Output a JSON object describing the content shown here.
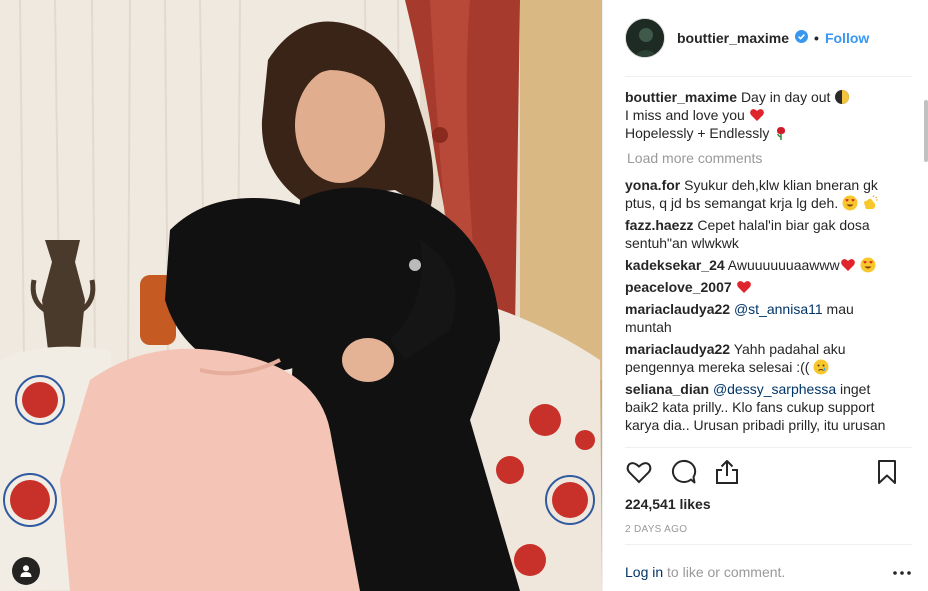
{
  "header": {
    "username": "bouttier_maxime",
    "separator": "•",
    "follow_label": "Follow"
  },
  "caption": {
    "username": "bouttier_maxime",
    "line1": "Day in day out",
    "line1_emoji": "moon-icon",
    "line2": "I miss and love you",
    "line2_emoji": "red-heart-icon",
    "line3": "Hopelessly + Endlessly",
    "line3_emoji": "rose-icon"
  },
  "load_more": "Load more comments",
  "comments": [
    {
      "username": "yona.for",
      "text": "Syukur deh,klw klian bneran gk ptus, q jd bs semangat krja lg deh.",
      "emojis": [
        "heart-eyes-icon",
        "clap-icon"
      ]
    },
    {
      "username": "fazz.haezz",
      "text": "Cepet halal'in biar gak dosa sentuh\"an wlwkwk",
      "emojis": []
    },
    {
      "username": "kadeksekar_24",
      "text": "Awuuuuuuaawww",
      "emojis": [
        "red-heart-icon",
        "heart-eyes-icon"
      ]
    },
    {
      "username": "peacelove_2007",
      "text": "",
      "emojis": [
        "red-heart-icon"
      ]
    },
    {
      "username": "mariaclaudya22",
      "mention": "@st_annisa11",
      "text": "mau muntah",
      "emojis": []
    },
    {
      "username": "mariaclaudya22",
      "text": "Yahh padahal aku pengennya mereka selesai :((",
      "emojis": [
        "crying-icon"
      ]
    },
    {
      "username": "seliana_dian",
      "mention": "@dessy_sarphessa",
      "text": "inget baik2 kata prilly.. Klo fans cukup support karya dia.. Urusan pribadi prilly, itu urusan",
      "emojis": []
    }
  ],
  "actions": {
    "like": "heart-icon",
    "comment": "comment-icon",
    "share": "share-icon",
    "save": "bookmark-icon"
  },
  "likes_label": "224,541 likes",
  "time_ago": "2 DAYS AGO",
  "login": {
    "link": "Log in",
    "rest": "to like or comment.",
    "more": "more-options-icon"
  },
  "colors": {
    "link_blue": "#3897f0",
    "mention_blue": "#003569",
    "muted": "#999999",
    "text": "#262626",
    "heart_red": "#ed4956"
  }
}
